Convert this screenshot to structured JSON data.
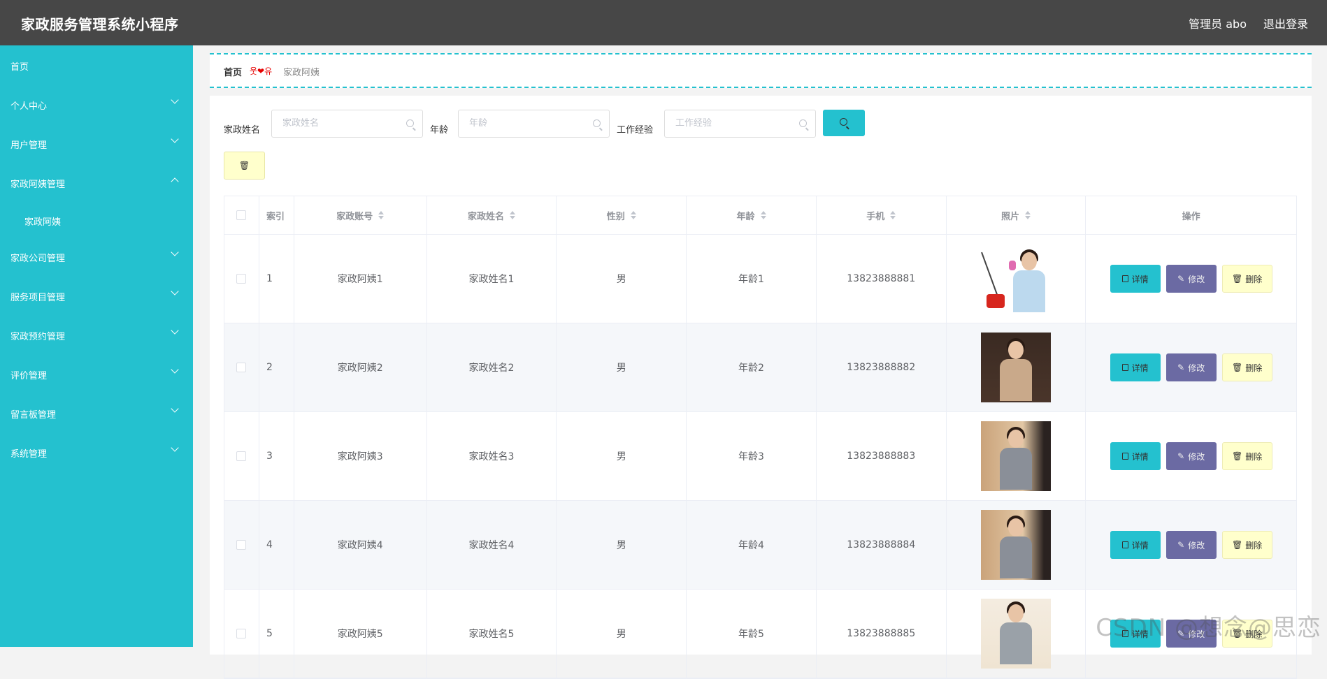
{
  "app": {
    "title": "家政服务管理系统小程序"
  },
  "header": {
    "admin_label": "管理员 abo",
    "logout_label": "退出登录"
  },
  "sidebar": {
    "items": [
      {
        "label": "首页",
        "chevron": "none"
      },
      {
        "label": "个人中心",
        "chevron": "down"
      },
      {
        "label": "用户管理",
        "chevron": "down"
      },
      {
        "label": "家政阿姨管理",
        "chevron": "up"
      },
      {
        "label": "家政阿姨",
        "chevron": "none",
        "sub": true
      },
      {
        "label": "家政公司管理",
        "chevron": "down"
      },
      {
        "label": "服务项目管理",
        "chevron": "down"
      },
      {
        "label": "家政预约管理",
        "chevron": "down"
      },
      {
        "label": "评价管理",
        "chevron": "down"
      },
      {
        "label": "留言板管理",
        "chevron": "down"
      },
      {
        "label": "系统管理",
        "chevron": "down"
      }
    ]
  },
  "breadcrumb": {
    "home": "首页",
    "separator": "웃❤유",
    "current": "家政阿姨"
  },
  "search": {
    "name_label": "家政姓名",
    "name_placeholder": "家政姓名",
    "age_label": "年龄",
    "age_placeholder": "年龄",
    "experience_label": "工作经验",
    "experience_placeholder": "工作经验"
  },
  "table": {
    "headers": {
      "index": "索引",
      "account": "家政账号",
      "name": "家政姓名",
      "gender": "性别",
      "age": "年龄",
      "phone": "手机",
      "photo": "照片",
      "ops": "操作"
    },
    "actions": {
      "detail": "详情",
      "edit": "修改",
      "delete": "删除"
    },
    "rows": [
      {
        "index": "1",
        "account": "家政阿姨1",
        "name": "家政姓名1",
        "gender": "男",
        "age": "年龄1",
        "phone": "13823888881"
      },
      {
        "index": "2",
        "account": "家政阿姨2",
        "name": "家政姓名2",
        "gender": "男",
        "age": "年龄2",
        "phone": "13823888882"
      },
      {
        "index": "3",
        "account": "家政阿姨3",
        "name": "家政姓名3",
        "gender": "男",
        "age": "年龄3",
        "phone": "13823888883"
      },
      {
        "index": "4",
        "account": "家政阿姨4",
        "name": "家政姓名4",
        "gender": "男",
        "age": "年龄4",
        "phone": "13823888884"
      },
      {
        "index": "5",
        "account": "家政阿姨5",
        "name": "家政姓名5",
        "gender": "男",
        "age": "年龄5",
        "phone": "13823888885"
      }
    ]
  },
  "watermark": "CSDN @想念@思恋",
  "colors": {
    "accent": "#24c1cf",
    "topbar": "#474747",
    "edit": "#6b6aa3",
    "delete": "#ffffcc"
  },
  "icons": {
    "search": "search-icon",
    "delete": "trash-icon",
    "detail": "document-icon",
    "edit": "pencil-icon"
  }
}
